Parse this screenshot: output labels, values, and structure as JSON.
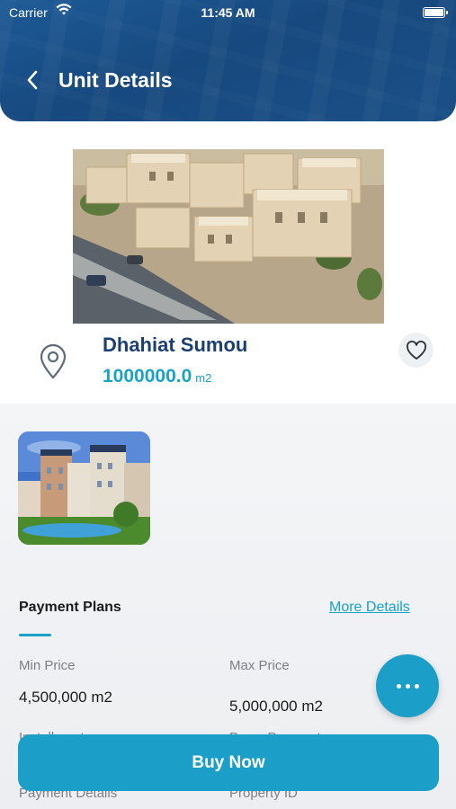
{
  "status_bar": {
    "carrier": "Carrier",
    "time": "11:45 AM"
  },
  "header": {
    "title": "Unit Details"
  },
  "unit": {
    "name": "Dhahiat Sumou",
    "area_value": "1000000.0",
    "area_unit": "m2"
  },
  "payment": {
    "tab_label": "Payment Plans",
    "more_details": "More Details",
    "min_price_label": "Min Price",
    "min_price_value": "4,500,000 m2",
    "max_price_label": "Max Price",
    "max_price_value": "5,000,000 m2",
    "partial_left_label": "Installments",
    "partial_right_label": "Down Payment",
    "payment_details_label": "Payment Details",
    "property_id_label": "Property ID"
  },
  "buy_button": {
    "label": "Buy Now"
  },
  "colors": {
    "accent": "#1b9ec8",
    "title_navy": "#1b3f73",
    "header_blue": "#17497f"
  },
  "icons": [
    "wifi-icon",
    "battery-icon",
    "back-chevron-icon",
    "location-pin-icon",
    "heart-icon",
    "more-dots-icon"
  ]
}
